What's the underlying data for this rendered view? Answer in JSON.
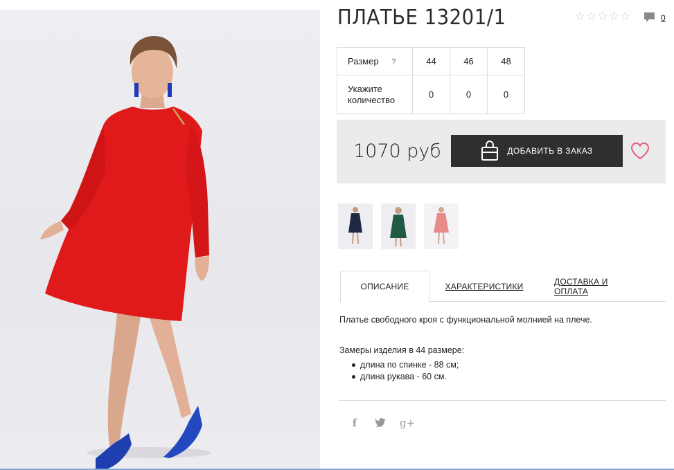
{
  "product": {
    "title": "ПЛАТЬЕ 13201/1",
    "rating_stars": 5,
    "rating_filled": 0,
    "comments_count": "0"
  },
  "sizes_table": {
    "size_label": "Размер",
    "help_label": "?",
    "qty_label_line1": "Укажите",
    "qty_label_line2": "количество",
    "sizes": [
      "44",
      "46",
      "48"
    ],
    "quantities": [
      "0",
      "0",
      "0"
    ]
  },
  "purchase": {
    "price": "1070 руб",
    "add_button_label": "ДОБАВИТЬ В ЗАКАЗ"
  },
  "thumbnails": [
    {
      "name": "navy",
      "color": "#1e2a44"
    },
    {
      "name": "green",
      "color": "#1f5a45"
    },
    {
      "name": "pink",
      "color": "#e88a8a"
    }
  ],
  "tabs": [
    {
      "label": "ОПИСАНИЕ",
      "active": true
    },
    {
      "label": "ХАРАКТЕРИСТИКИ",
      "active": false
    },
    {
      "label": "ДОСТАВКА И ОПЛАТА",
      "active": false
    }
  ],
  "description": {
    "text": "Платье свободного кроя с функциональной молнией на плече.",
    "measurements_title": "Замеры изделия в 44 размере:",
    "measurements": [
      "длина по спинке - 88 см;",
      "длина рукава - 60 см."
    ]
  },
  "social": {
    "facebook": "f",
    "twitter": "t",
    "google": "g+"
  },
  "colors": {
    "dress_red": "#e0191b",
    "button_dark": "#2f2f2f",
    "heart_pink": "#e0607a",
    "panel_gray": "#ebebeb",
    "shoe_blue": "#1f3fb0"
  }
}
